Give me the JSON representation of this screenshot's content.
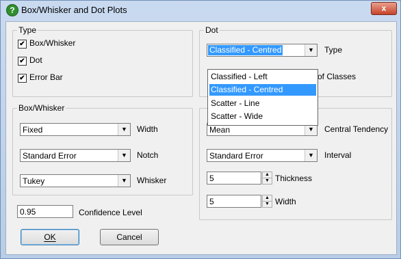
{
  "window": {
    "title": "Box/Whisker and Dot Plots",
    "close_glyph": "x",
    "icon": "help-question-icon"
  },
  "type_group": {
    "label": "Type",
    "items": [
      {
        "label": "Box/Whisker",
        "checked": true
      },
      {
        "label": "Dot",
        "checked": true
      },
      {
        "label": "Error Bar",
        "checked": true
      }
    ]
  },
  "boxwhisker_group": {
    "label": "Box/Whisker",
    "width": {
      "value": "Fixed",
      "label": "Width"
    },
    "notch": {
      "value": "Standard Error",
      "label": "Notch"
    },
    "whisker": {
      "value": "Tukey",
      "label": "Whisker"
    }
  },
  "confidence": {
    "value": "0.95",
    "label": "Confidence Level"
  },
  "dot_group": {
    "label": "Dot",
    "type": {
      "value": "Classified - Centred",
      "label": "Type"
    },
    "classes_label": "of Classes",
    "dropdown_options": [
      "Classified - Left",
      "Classified - Centred",
      "Scatter - Line",
      "Scatter - Wide"
    ],
    "dropdown_selected": "Classified - Centred"
  },
  "errorbar_group": {
    "central_tendency": {
      "value": "Mean",
      "label": "Central Tendency"
    },
    "interval": {
      "value": "Standard Error",
      "label": "Interval"
    },
    "thickness": {
      "value": "5",
      "label": "Thickness"
    },
    "width": {
      "value": "5",
      "label": "Width"
    }
  },
  "buttons": {
    "ok": "OK",
    "cancel": "Cancel"
  },
  "colors": {
    "selection": "#3399ff",
    "dialog_bg": "#f0f0f0"
  }
}
